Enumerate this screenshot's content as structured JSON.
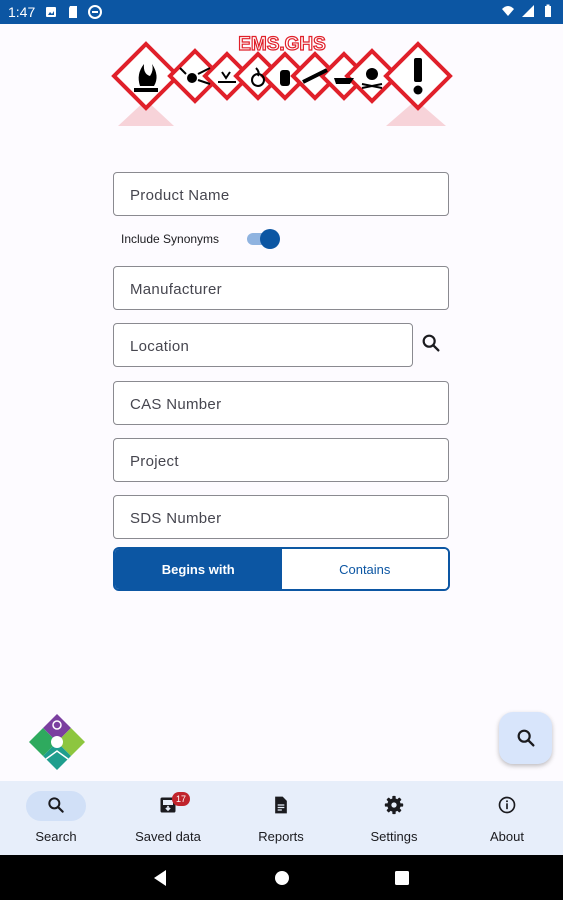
{
  "status_bar": {
    "time": "1:47"
  },
  "logo": {
    "brand_text": "EMS.GHS"
  },
  "search_form": {
    "product_name": {
      "placeholder": "Product Name",
      "value": ""
    },
    "include_synonyms": {
      "label": "Include Synonyms",
      "enabled": true
    },
    "manufacturer": {
      "placeholder": "Manufacturer",
      "value": ""
    },
    "location": {
      "placeholder": "Location",
      "value": ""
    },
    "cas_number": {
      "placeholder": "CAS Number",
      "value": ""
    },
    "project": {
      "placeholder": "Project",
      "value": ""
    },
    "sds_number": {
      "placeholder": "SDS Number",
      "value": ""
    },
    "match_mode": {
      "options": [
        "Begins with",
        "Contains"
      ],
      "selected": "Begins with"
    }
  },
  "fab": {
    "icon": "search-icon"
  },
  "bottom_nav": {
    "items": [
      {
        "label": "Search",
        "icon": "search-icon",
        "selected": true
      },
      {
        "label": "Saved data",
        "icon": "saved-data-icon",
        "badge": "17"
      },
      {
        "label": "Reports",
        "icon": "report-icon"
      },
      {
        "label": "Settings",
        "icon": "gear-icon"
      },
      {
        "label": "About",
        "icon": "info-icon"
      }
    ]
  },
  "colors": {
    "primary": "#0c56a3",
    "status_bar": "#0c56a3",
    "nav_background": "#e7eefa",
    "badge": "#c0232b",
    "hazard_red": "#e0202a"
  }
}
